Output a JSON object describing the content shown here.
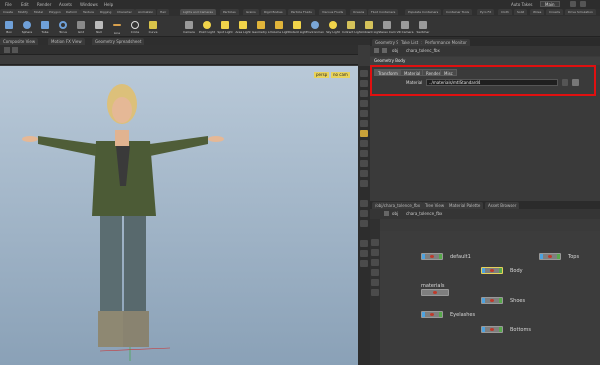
{
  "menubar": {
    "items": [
      "File",
      "Edit",
      "Render",
      "Assets",
      "Windows",
      "Help"
    ],
    "right_items": [
      "Auto Takes",
      "Main"
    ]
  },
  "shelf": {
    "tabs": [
      "Create",
      "Modify",
      "Model",
      "Polygon",
      "Deform",
      "Texture",
      "Rigging",
      "Character",
      "Animation",
      "Hair",
      "Cloud FX",
      "Volume"
    ],
    "right_tabs": [
      "Lights and Cameras",
      "Particles",
      "Grains",
      "Rigid Bodies",
      "Particle Fluids",
      "Viscous Fluids",
      "Oceans",
      "Fluid Containers",
      "Populate Containers",
      "Container Tools",
      "Pyro FX",
      "Cloth",
      "Solid",
      "Wires",
      "Crowds",
      "Drive Simulation"
    ],
    "left_tools": [
      "Box",
      "Sphere",
      "Tube",
      "Torus",
      "Grid",
      "Null",
      "Line",
      "Circle",
      "Curve",
      "Draw Curve",
      "Spray Paint",
      "Font",
      "Platonic",
      "L-System",
      "Metaball"
    ],
    "right_tools": [
      "Camera",
      "Point Light",
      "Spot Light",
      "Area Light",
      "Geometry Light",
      "Volume Light",
      "Distant Light",
      "Environment",
      "Sky Light",
      "Indirect Light",
      "Ambient Light",
      "Stereo Cam",
      "VR Camera",
      "Switcher"
    ]
  },
  "viewport": {
    "tabs": [
      "Composite View",
      "Motion FX View",
      "Geometry Spreadsheet"
    ],
    "badges": [
      "persp",
      "no cam"
    ]
  },
  "param_pane": {
    "tabs": [
      "Geometry Spreadsheet",
      "Take List",
      "Performance Monitor"
    ],
    "path": "obj",
    "node_name": "chara_tolenc_fbx",
    "title": "Geometry  Body",
    "sub_tabs": [
      "Transform",
      "Material",
      "Render",
      "Misc"
    ],
    "material_label": "Material",
    "material_value": "../materials/mtlStandard4"
  },
  "network_pane": {
    "tabs": [
      "/obj/chara_tolence_fbx",
      "Tree View",
      "Material Palette",
      "Asset Browser"
    ],
    "path": "obj",
    "node_path": "chara_tolence_fbx",
    "nodes": [
      {
        "label": "default1"
      },
      {
        "label": "Tops"
      },
      {
        "label": "Body"
      },
      {
        "label": "materials"
      },
      {
        "label": "Shoes"
      },
      {
        "label": "Eyelashes"
      },
      {
        "label": "Bottoms"
      }
    ]
  },
  "colors": {
    "highlight_red": "#e01010",
    "bg_dark": "#3a3a3a"
  }
}
